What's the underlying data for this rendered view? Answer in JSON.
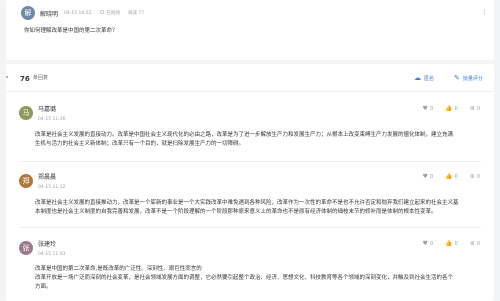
{
  "question": {
    "author_name": "解晓明",
    "author_initial": "解",
    "time": "04-15 10:52",
    "checked_label": "已批阅",
    "view_label": "阅读 77",
    "content": "你如何理解改革是中国的第二次革命？",
    "more_icon": "more-vertical-icon"
  },
  "answers_header": {
    "count": "76",
    "count_label": "条回复",
    "anonymous_label": "匿名",
    "batch_review_label": "批量评分"
  },
  "answers": [
    {
      "name": "马嘉璐",
      "initial": "马",
      "time": "04-15 11:36",
      "content_lines": [
        "改革是社会主义发展的直接动力。改革是中国社会主义现代化的必由之路，改革是为了进一步解放生产力和发展生产力；从根本上改变束缚生产力发展的僵化体制，建立充满",
        "生机与活力的社会主义新体制；改革只有一个目的，就是扫除发展生产力的一切障碍。"
      ],
      "comments": "0",
      "likes": "0",
      "score": "0",
      "avatar_color": "#8a9a5b"
    },
    {
      "name": "郑晨晨",
      "initial": "郑",
      "time": "04-15 11:12",
      "content_lines": [
        "改革是社会主义发展的直接推动力，改革是一个崭新的事业是一个大实践改革中难免遇到各种风险，改革作为一次性的革命不是也不允许否定和抛弃我们建立起来的社会主义基",
        "本制度也是社会主义制度的自我完善和发展，改革不是一个阶段理解的一个阶段那种原来意义上的革命也不是原有经济体制的细枝末节的修补而是体制的根本性变革。"
      ],
      "comments": "0",
      "likes": "0",
      "score": "0",
      "avatar_color": "#b07a3a"
    },
    {
      "name": "张建玲",
      "initial": "张",
      "time": "04-15 11:03",
      "content_lines": [
        "改革是中国的第二次革命,是既改革的广泛性、深刻性、艰巨性而言的",
        "改革开放是一场广泛而深刻的社会变革，是社会领域发展方面的调整，它必然要引起整个政治、经济、思想文化、科技教育等各个领域的深刻变化，并触及到社会生活的各个",
        "方面。"
      ],
      "comments": "0",
      "likes": "0",
      "score": "0",
      "avatar_color": "#9b7b8a"
    }
  ],
  "colors": {
    "accent": "#3a7bd5"
  }
}
